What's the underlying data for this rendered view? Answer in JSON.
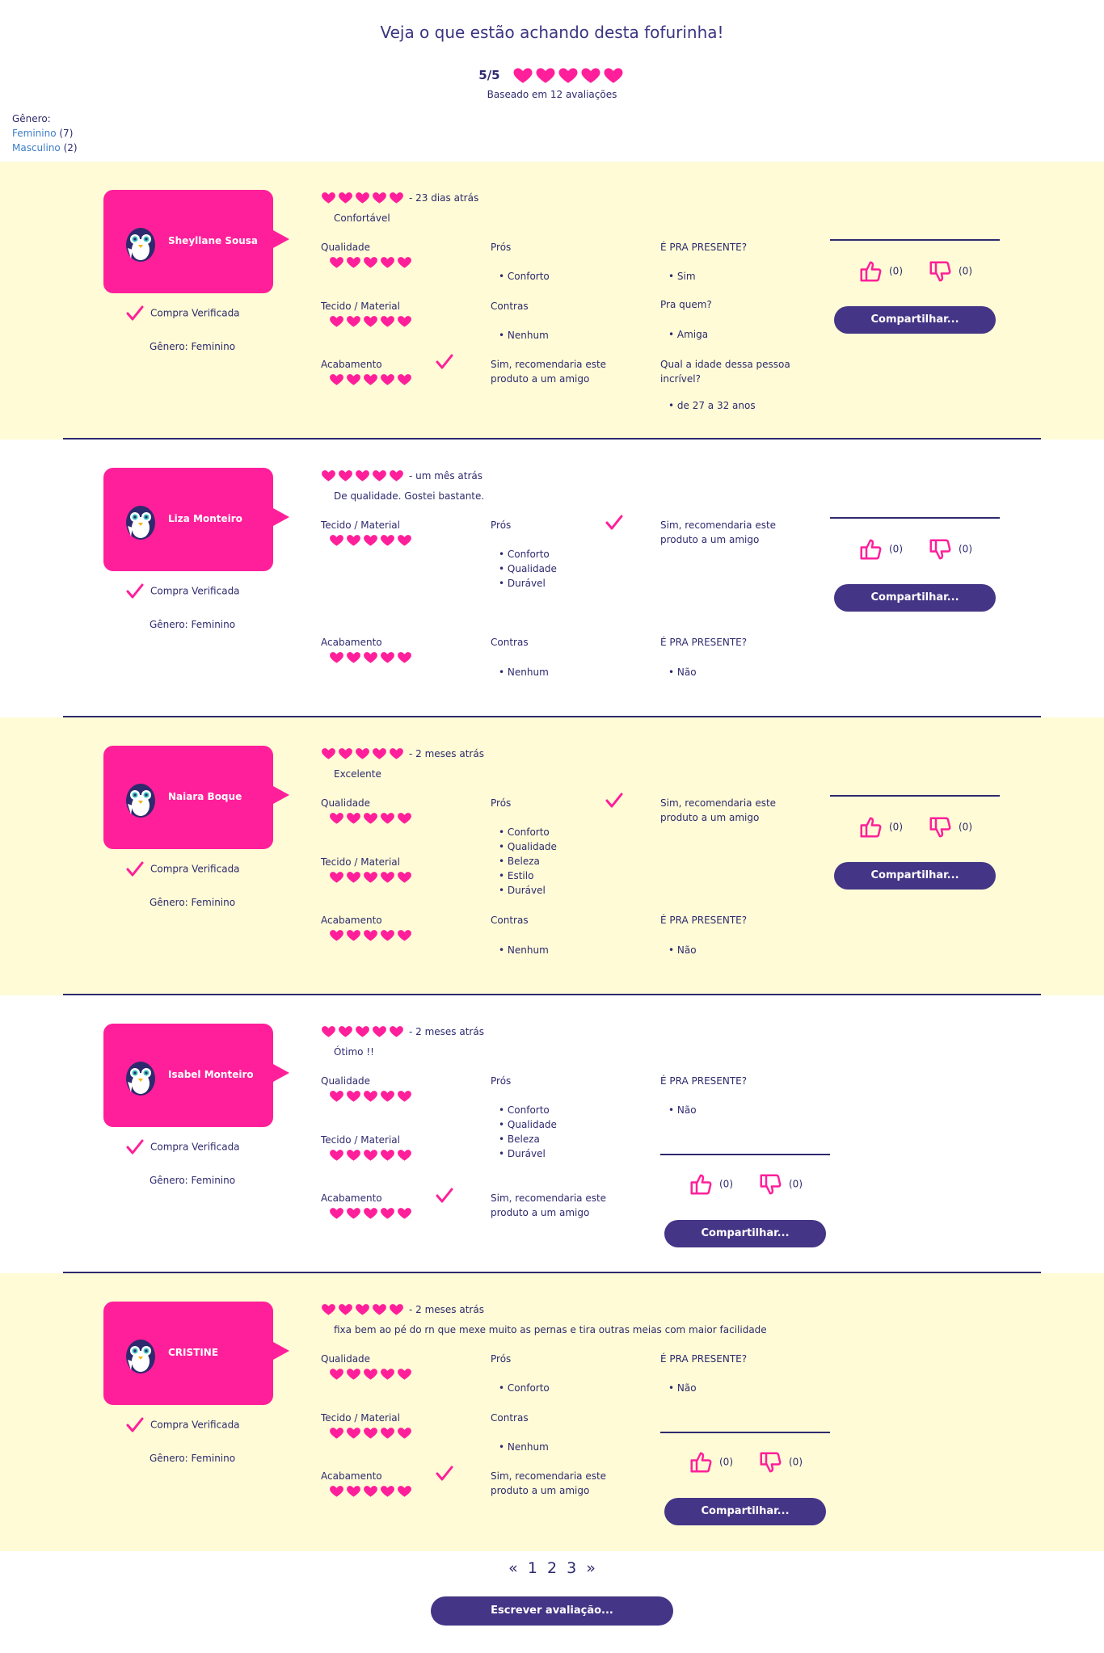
{
  "page": {
    "title": "Veja o que estão achando desta fofurinha!",
    "score": "5/5",
    "basis": "Baseado em 12 avaliações",
    "accent": "#ff1f9a",
    "primary": "#453586",
    "text_color": "#2e2a6e"
  },
  "filter": {
    "label": "Gênero:",
    "options": [
      {
        "name": "Feminino",
        "count": "(7)"
      },
      {
        "name": "Masculino",
        "count": "(2)"
      }
    ]
  },
  "common": {
    "verified": "Compra Verificada",
    "share": "Compartilhar...",
    "label_qualidade": "Qualidade",
    "label_tecido": "Tecido / Material",
    "label_acabamento": "Acabamento",
    "label_pros": "Prós",
    "label_contras": "Contras",
    "label_presente": "É PRA PRESENTE?",
    "recommend_line1": "Sim, recomendaria este",
    "recommend_line2": "produto a um amigo"
  },
  "reviews": [
    {
      "name": "Sheyllane Sousa",
      "time": "- 23 dias atrás",
      "headline": "Confortável",
      "gender": "Gênero: Feminino",
      "pros": [
        "• Conforto"
      ],
      "contras": [
        "• Nenhum"
      ],
      "presente": "• Sim",
      "para_quem_label": "Pra quem?",
      "para_quem": "• Amiga",
      "idade_label_1": "Qual a idade dessa pessoa",
      "idade_label_2": "incrível?",
      "idade": "• de 27 a 32 anos",
      "likes": "(0)",
      "dislikes": "(0)"
    },
    {
      "name": "Liza Monteiro",
      "time": "- um mês atrás",
      "headline": "De qualidade. Gostei bastante.",
      "gender": "Gênero: Feminino",
      "pros": [
        "• Conforto",
        "• Qualidade",
        "• Durável"
      ],
      "contras": [
        "• Nenhum"
      ],
      "presente": "• Não",
      "likes": "(0)",
      "dislikes": "(0)"
    },
    {
      "name": "Naiara Boque",
      "time": "- 2 meses atrás",
      "headline": "Excelente",
      "gender": "Gênero: Feminino",
      "pros": [
        "• Conforto",
        "• Qualidade",
        "• Beleza",
        "• Estilo",
        "• Durável"
      ],
      "contras": [
        "• Nenhum"
      ],
      "presente": "• Não",
      "likes": "(0)",
      "dislikes": "(0)"
    },
    {
      "name": "Isabel Monteiro",
      "time": "- 2 meses atrás",
      "headline": "Ótimo !!",
      "gender": "Gênero: Feminino",
      "pros": [
        "• Conforto",
        "• Qualidade",
        "• Beleza",
        "• Durável"
      ],
      "contras": [],
      "presente": "• Não",
      "likes": "(0)",
      "dislikes": "(0)"
    },
    {
      "name": "CRISTINE",
      "time": "- 2 meses atrás",
      "headline": "fixa bem ao pé do rn que mexe muito as pernas e tira outras meias com maior facilidade",
      "gender": "Gênero: Feminino",
      "pros": [
        "• Conforto"
      ],
      "contras": [
        "• Nenhum"
      ],
      "presente": "• Não",
      "likes": "(0)",
      "dislikes": "(0)"
    }
  ],
  "pagination": {
    "prev": "«",
    "pages": [
      "1",
      "2",
      "3"
    ],
    "next": "»"
  },
  "write_review": "Escrever avaliação..."
}
